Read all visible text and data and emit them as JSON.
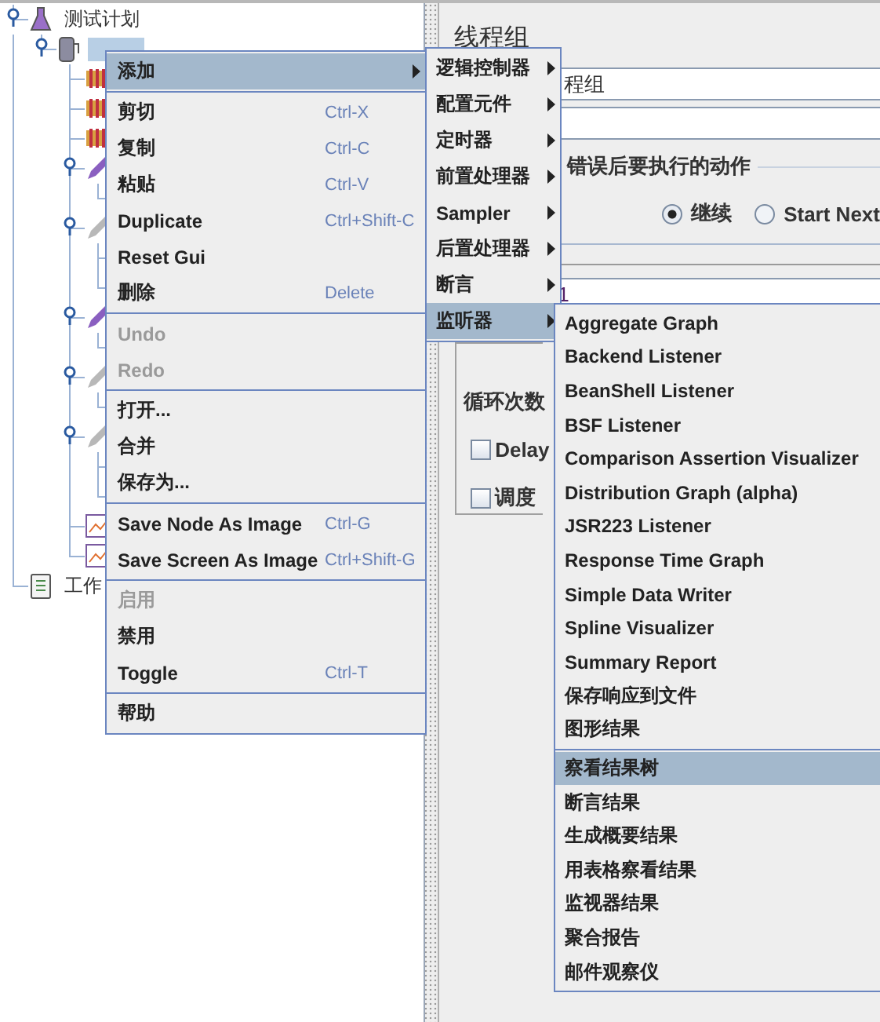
{
  "tree": [
    {
      "label": "测试计划",
      "kind": "plan",
      "expanded": true,
      "selected": false,
      "children": [
        {
          "kind": "thread",
          "expanded": true,
          "selected": true,
          "children": [
            {
              "kind": "sampler"
            },
            {
              "kind": "sampler"
            },
            {
              "kind": "sampler"
            },
            {
              "kind": "pencil",
              "enabled": true,
              "expanded": true,
              "children": [
                {
                  "kind": "leaf"
                }
              ]
            },
            {
              "kind": "pencil",
              "enabled": false,
              "expanded": true,
              "children": [
                {
                  "kind": "leaf"
                },
                {
                  "kind": "leaf"
                }
              ]
            },
            {
              "kind": "pencil",
              "enabled": true,
              "expanded": true,
              "children": [
                {
                  "kind": "leaf"
                }
              ]
            },
            {
              "kind": "pencil",
              "enabled": false,
              "expanded": true,
              "children": [
                {
                  "kind": "leaf"
                }
              ]
            },
            {
              "kind": "pencil",
              "enabled": false,
              "expanded": true,
              "children": [
                {
                  "kind": "leaf"
                },
                {
                  "kind": "leaf"
                }
              ]
            },
            {
              "kind": "chart"
            },
            {
              "kind": "chart"
            }
          ]
        }
      ]
    },
    {
      "label": "工作",
      "kind": "workbench",
      "selected": false
    }
  ],
  "panel": {
    "title": "线程组",
    "name_value": "程组",
    "error_group": {
      "legend": "错误后要执行的动作",
      "options": [
        {
          "label": "继续",
          "selected": true
        },
        {
          "label": "Start Next",
          "selected": false
        }
      ]
    },
    "threads_value": "1",
    "loop_label": "循环次数",
    "checks": [
      {
        "label": "Delay",
        "checked": false
      },
      {
        "label": "调度",
        "checked": false
      }
    ]
  },
  "context_menu": [
    {
      "kind": "item",
      "label": "添加",
      "submenu": true,
      "selected": true,
      "disabled": false
    },
    {
      "kind": "separator"
    },
    {
      "kind": "item",
      "label": "剪切",
      "shortcut": "Ctrl-X",
      "submenu": false,
      "selected": false,
      "disabled": false
    },
    {
      "kind": "item",
      "label": "复制",
      "shortcut": "Ctrl-C",
      "submenu": false,
      "selected": false,
      "disabled": false
    },
    {
      "kind": "item",
      "label": "粘贴",
      "shortcut": "Ctrl-V",
      "submenu": false,
      "selected": false,
      "disabled": false
    },
    {
      "kind": "item",
      "label": "Duplicate",
      "shortcut": "Ctrl+Shift-C",
      "submenu": false,
      "selected": false,
      "disabled": false
    },
    {
      "kind": "item",
      "label": "Reset Gui",
      "submenu": false,
      "selected": false,
      "disabled": false
    },
    {
      "kind": "item",
      "label": "删除",
      "shortcut": "Delete",
      "submenu": false,
      "selected": false,
      "disabled": false
    },
    {
      "kind": "separator"
    },
    {
      "kind": "item",
      "label": "Undo",
      "submenu": false,
      "selected": false,
      "disabled": true
    },
    {
      "kind": "item",
      "label": "Redo",
      "submenu": false,
      "selected": false,
      "disabled": true
    },
    {
      "kind": "separator"
    },
    {
      "kind": "item",
      "label": "打开...",
      "submenu": false,
      "selected": false,
      "disabled": false
    },
    {
      "kind": "item",
      "label": "合并",
      "submenu": false,
      "selected": false,
      "disabled": false
    },
    {
      "kind": "item",
      "label": "保存为...",
      "submenu": false,
      "selected": false,
      "disabled": false
    },
    {
      "kind": "separator"
    },
    {
      "kind": "item",
      "label": "Save Node As Image",
      "shortcut": "Ctrl-G",
      "submenu": false,
      "selected": false,
      "disabled": false
    },
    {
      "kind": "item",
      "label": "Save Screen As Image",
      "shortcut": "Ctrl+Shift-G",
      "submenu": false,
      "selected": false,
      "disabled": false
    },
    {
      "kind": "separator"
    },
    {
      "kind": "item",
      "label": "启用",
      "submenu": false,
      "selected": false,
      "disabled": true
    },
    {
      "kind": "item",
      "label": "禁用",
      "submenu": false,
      "selected": false,
      "disabled": false
    },
    {
      "kind": "item",
      "label": "Toggle",
      "shortcut": "Ctrl-T",
      "submenu": false,
      "selected": false,
      "disabled": false
    },
    {
      "kind": "separator"
    },
    {
      "kind": "item",
      "label": "帮助",
      "submenu": false,
      "selected": false,
      "disabled": false
    }
  ],
  "add_submenu": [
    {
      "kind": "item",
      "label": "逻辑控制器",
      "submenu": true,
      "selected": false,
      "disabled": false
    },
    {
      "kind": "item",
      "label": "配置元件",
      "submenu": true,
      "selected": false,
      "disabled": false
    },
    {
      "kind": "item",
      "label": "定时器",
      "submenu": true,
      "selected": false,
      "disabled": false
    },
    {
      "kind": "item",
      "label": "前置处理器",
      "submenu": true,
      "selected": false,
      "disabled": false
    },
    {
      "kind": "item",
      "label": "Sampler",
      "submenu": true,
      "selected": false,
      "disabled": false
    },
    {
      "kind": "item",
      "label": "后置处理器",
      "submenu": true,
      "selected": false,
      "disabled": false
    },
    {
      "kind": "item",
      "label": "断言",
      "submenu": true,
      "selected": false,
      "disabled": false
    },
    {
      "kind": "item",
      "label": "监听器",
      "submenu": true,
      "selected": true,
      "disabled": false
    }
  ],
  "listener_submenu": [
    {
      "kind": "item",
      "label": "Aggregate Graph",
      "selected": false,
      "disabled": false
    },
    {
      "kind": "item",
      "label": "Backend Listener",
      "selected": false,
      "disabled": false
    },
    {
      "kind": "item",
      "label": "BeanShell Listener",
      "selected": false,
      "disabled": false
    },
    {
      "kind": "item",
      "label": "BSF Listener",
      "selected": false,
      "disabled": false
    },
    {
      "kind": "item",
      "label": "Comparison Assertion Visualizer",
      "selected": false,
      "disabled": false
    },
    {
      "kind": "item",
      "label": "Distribution Graph (alpha)",
      "selected": false,
      "disabled": false
    },
    {
      "kind": "item",
      "label": "JSR223 Listener",
      "selected": false,
      "disabled": false
    },
    {
      "kind": "item",
      "label": "Response Time Graph",
      "selected": false,
      "disabled": false
    },
    {
      "kind": "item",
      "label": "Simple Data Writer",
      "selected": false,
      "disabled": false
    },
    {
      "kind": "item",
      "label": "Spline Visualizer",
      "selected": false,
      "disabled": false
    },
    {
      "kind": "item",
      "label": "Summary Report",
      "selected": false,
      "disabled": false
    },
    {
      "kind": "item",
      "label": "保存响应到文件",
      "selected": false,
      "disabled": false
    },
    {
      "kind": "item",
      "label": "图形结果",
      "selected": false,
      "disabled": false
    },
    {
      "kind": "separator"
    },
    {
      "kind": "item",
      "label": "察看结果树",
      "selected": true,
      "disabled": false
    },
    {
      "kind": "item",
      "label": "断言结果",
      "selected": false,
      "disabled": false
    },
    {
      "kind": "item",
      "label": "生成概要结果",
      "selected": false,
      "disabled": false
    },
    {
      "kind": "item",
      "label": "用表格察看结果",
      "selected": false,
      "disabled": false
    },
    {
      "kind": "item",
      "label": "监视器结果",
      "selected": false,
      "disabled": false
    },
    {
      "kind": "item",
      "label": "聚合报告",
      "selected": false,
      "disabled": false
    },
    {
      "kind": "item",
      "label": "邮件观察仪",
      "selected": false,
      "disabled": false
    }
  ]
}
